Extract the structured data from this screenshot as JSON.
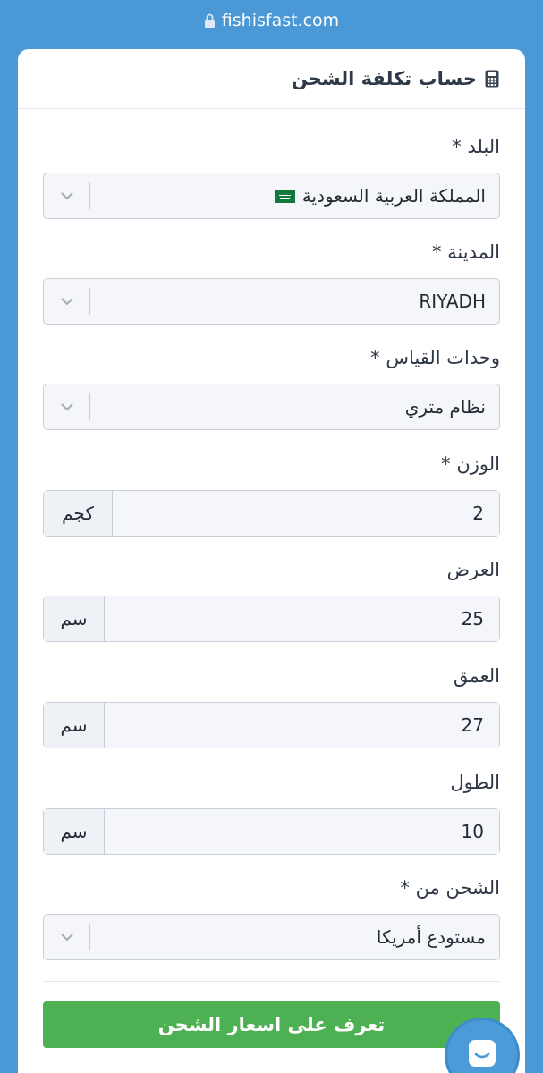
{
  "browser": {
    "url": "fishisfast.com"
  },
  "card": {
    "title": "حساب تكلفة الشحن"
  },
  "fields": {
    "country": {
      "label": "البلد *",
      "value": "المملكة العربية السعودية"
    },
    "city": {
      "label": "المدينة *",
      "value": "RIYADH"
    },
    "units": {
      "label": "وحدات القياس *",
      "value": "نظام متري"
    },
    "weight": {
      "label": "الوزن *",
      "value": "2",
      "unit": "كجم"
    },
    "width": {
      "label": "العرض",
      "value": "25",
      "unit": "سم"
    },
    "depth": {
      "label": "العمق",
      "value": "27",
      "unit": "سم"
    },
    "length": {
      "label": "الطول",
      "value": "10",
      "unit": "سم"
    },
    "ship_from": {
      "label": "الشحن من *",
      "value": "مستودع أمريكا"
    }
  },
  "submit": {
    "label": "تعرف على اسعار الشحن"
  },
  "colors": {
    "header_blue": "#4a98d6",
    "submit_green": "#4db052",
    "chat_blue": "#4b9bd8"
  }
}
